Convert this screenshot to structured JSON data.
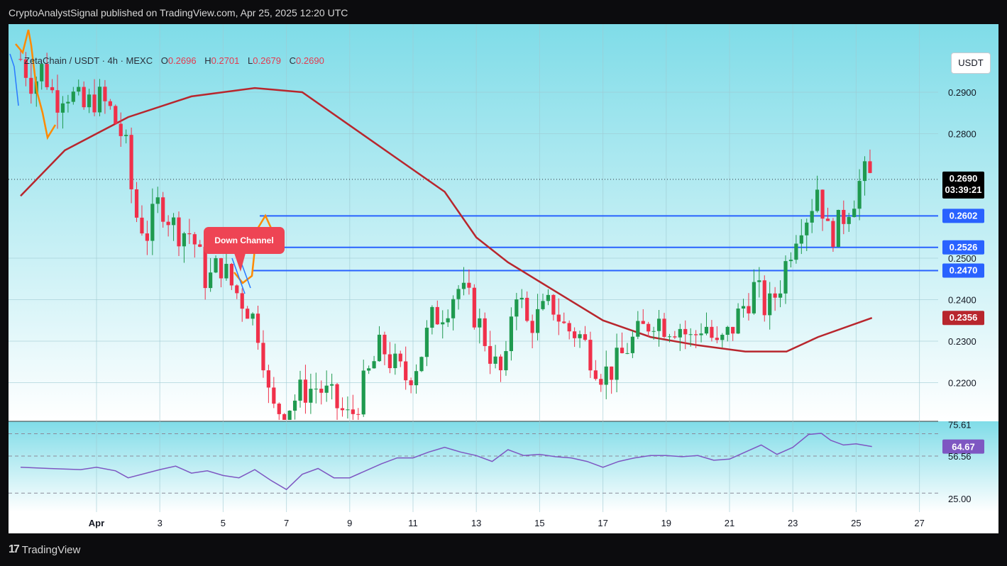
{
  "header": {
    "publisher_line": "CryptoAnalystSignal published on TradingView.com, Apr 25, 2025 12:20 UTC"
  },
  "legend": {
    "symbol": "ZetaChain / USDT · 4h · MEXC",
    "open_label": "O",
    "open": "0.2696",
    "high_label": "H",
    "high": "0.2701",
    "low_label": "L",
    "low": "0.2679",
    "close_label": "C",
    "close": "0.2690"
  },
  "currency_button": "USDT",
  "annotation": {
    "text": "Down Channel"
  },
  "footer": {
    "brand": "TradingView"
  },
  "colors": {
    "bg_top": "#7fdce8",
    "bg_bottom": "#ffffff",
    "up": "#1f9a4f",
    "down": "#f0304a",
    "ma": "#b8262d",
    "level": "#2962ff",
    "rsi_line": "#7e57c2",
    "pattern": "#ff8a00",
    "channel": "#2979ff"
  },
  "chart_data": [
    {
      "type": "candlestick",
      "symbol": "ZetaChain / USDT",
      "timeframe": "4h",
      "exchange": "MEXC",
      "x_tick_labels": [
        "Apr",
        "3",
        "5",
        "7",
        "9",
        "11",
        "13",
        "15",
        "17",
        "19",
        "21",
        "23",
        "25",
        "27"
      ],
      "y_tick_labels": [
        "0.2900",
        "0.2800",
        "0.2500",
        "0.2400",
        "0.2300",
        "0.2200"
      ],
      "ylim": [
        0.211,
        0.306
      ],
      "horizontal_levels": [
        0.2602,
        0.2526,
        0.247
      ],
      "last_price": 0.269,
      "countdown": "03:39:21",
      "moving_average_last": 0.2356,
      "price_label_values": [
        "0.2690",
        "0.2602",
        "0.2526",
        "0.2470",
        "0.2356"
      ],
      "candles_close_path": [
        [
          -1.4,
          0.298
        ],
        [
          -1.0,
          0.292
        ],
        [
          -0.7,
          0.296
        ],
        [
          -0.3,
          0.288
        ],
        [
          0.0,
          0.291
        ],
        [
          0.6,
          0.286
        ],
        [
          1.0,
          0.289
        ],
        [
          1.4,
          0.286
        ],
        [
          1.9,
          0.278
        ],
        [
          2.2,
          0.261
        ],
        [
          2.6,
          0.256
        ],
        [
          3.0,
          0.264
        ],
        [
          3.5,
          0.257
        ],
        [
          4.0,
          0.256
        ],
        [
          4.5,
          0.244
        ],
        [
          4.9,
          0.249
        ],
        [
          5.3,
          0.243
        ],
        [
          5.8,
          0.238
        ],
        [
          6.2,
          0.231
        ],
        [
          6.5,
          0.213
        ],
        [
          7.0,
          0.214
        ],
        [
          7.5,
          0.218
        ],
        [
          8.0,
          0.219
        ],
        [
          8.4,
          0.216
        ],
        [
          9.0,
          0.211
        ],
        [
          9.6,
          0.222
        ],
        [
          10.0,
          0.229
        ],
        [
          10.4,
          0.224
        ],
        [
          10.8,
          0.221
        ],
        [
          11.2,
          0.226
        ],
        [
          11.6,
          0.235
        ],
        [
          12.0,
          0.238
        ],
        [
          12.4,
          0.243
        ],
        [
          12.8,
          0.239
        ],
        [
          13.2,
          0.232
        ],
        [
          13.6,
          0.224
        ],
        [
          13.9,
          0.221
        ],
        [
          14.2,
          0.245
        ],
        [
          14.6,
          0.234
        ],
        [
          15.0,
          0.236
        ],
        [
          15.4,
          0.239
        ],
        [
          15.8,
          0.233
        ],
        [
          16.2,
          0.232
        ],
        [
          16.6,
          0.227
        ],
        [
          17.0,
          0.222
        ],
        [
          17.4,
          0.224
        ],
        [
          17.8,
          0.229
        ],
        [
          18.2,
          0.232
        ],
        [
          18.6,
          0.236
        ],
        [
          19.0,
          0.234
        ],
        [
          19.4,
          0.234
        ],
        [
          19.8,
          0.23
        ],
        [
          20.2,
          0.235
        ],
        [
          20.6,
          0.228
        ],
        [
          21.0,
          0.232
        ],
        [
          21.4,
          0.238
        ],
        [
          21.8,
          0.243
        ],
        [
          22.2,
          0.237
        ],
        [
          22.6,
          0.244
        ],
        [
          22.9,
          0.252
        ],
        [
          23.2,
          0.259
        ],
        [
          23.5,
          0.261
        ],
        [
          23.8,
          0.268
        ],
        [
          24.1,
          0.256
        ],
        [
          24.4,
          0.257
        ],
        [
          24.7,
          0.262
        ],
        [
          25.0,
          0.266
        ],
        [
          25.2,
          0.27
        ],
        [
          25.5,
          0.269
        ]
      ],
      "moving_average_path": [
        [
          -1.4,
          0.265
        ],
        [
          0.0,
          0.276
        ],
        [
          2.0,
          0.284
        ],
        [
          4.0,
          0.289
        ],
        [
          6.0,
          0.291
        ],
        [
          7.5,
          0.29
        ],
        [
          9.0,
          0.282
        ],
        [
          10.5,
          0.274
        ],
        [
          12.0,
          0.266
        ],
        [
          13.0,
          0.255
        ],
        [
          14.0,
          0.249
        ],
        [
          15.5,
          0.242
        ],
        [
          17.0,
          0.235
        ],
        [
          18.5,
          0.231
        ],
        [
          20.0,
          0.229
        ],
        [
          21.5,
          0.2275
        ],
        [
          22.8,
          0.2275
        ],
        [
          23.8,
          0.231
        ],
        [
          25.5,
          0.2356
        ]
      ]
    },
    {
      "type": "line",
      "indicator": "RSI",
      "ylim": [
        10,
        85
      ],
      "levels": [
        75.61,
        56.56,
        25.0
      ],
      "current_value": 64.67,
      "price_label_values": [
        "75.61",
        "64.67",
        "56.56",
        "25.00"
      ],
      "series": [
        {
          "x": [
            -1.4,
            -0.5,
            0.5,
            1.0,
            1.6,
            2.0,
            3.0,
            3.5,
            4.0,
            4.5,
            5.0,
            5.5,
            6.0,
            6.5,
            7.0,
            7.5,
            8.0,
            8.5,
            9.0,
            9.5,
            10.0,
            10.5,
            11.0,
            11.5,
            12.0,
            12.5,
            13.0,
            13.5,
            14.0,
            14.5,
            15.0,
            15.5,
            16.0,
            16.5,
            17.0,
            17.5,
            18.0,
            18.5,
            19.0,
            19.5,
            20.0,
            20.5,
            21.0,
            21.5,
            22.0,
            22.5,
            23.0,
            23.5,
            23.9,
            24.2,
            24.6,
            25.0,
            25.5
          ],
          "y": [
            47,
            46,
            45,
            47,
            44,
            38,
            45,
            48,
            42,
            44,
            40,
            38,
            45,
            36,
            28,
            41,
            46,
            38,
            38,
            44,
            50,
            55,
            55,
            60,
            64,
            60,
            57,
            52,
            62,
            57,
            58,
            56,
            55,
            52,
            47,
            52,
            55,
            57,
            57,
            56,
            57,
            53,
            54,
            60,
            66,
            58,
            64,
            75,
            76,
            70,
            66,
            67,
            64.67
          ]
        }
      ]
    }
  ]
}
